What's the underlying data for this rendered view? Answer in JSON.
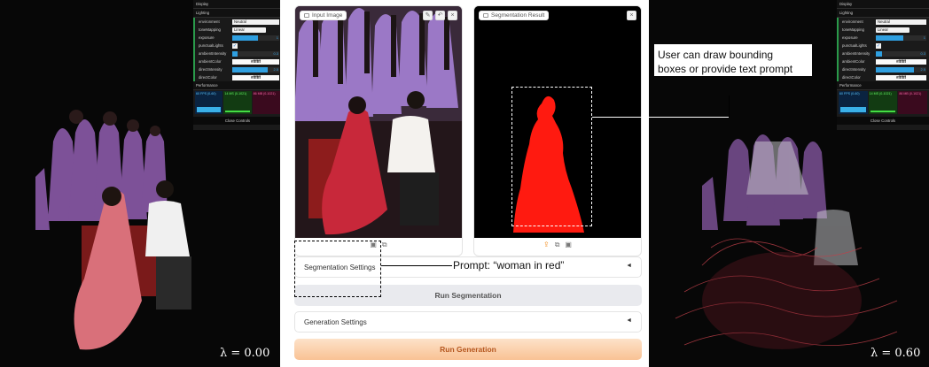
{
  "left_viewer": {
    "lambda_label": "λ = 0.00",
    "gui": {
      "folders": [
        "Display",
        "Lighting",
        "Performance"
      ],
      "environment": {
        "label": "environment",
        "value": "Neutral"
      },
      "toneMapping": {
        "label": "toneMapping",
        "value": "Linear"
      },
      "exposure": {
        "label": "exposure",
        "value": "1",
        "level": 0.55
      },
      "punctualLights": {
        "label": "punctualLights",
        "checked": true
      },
      "ambientIntensity": {
        "label": "ambientIntensity",
        "value": "0.3",
        "level": 0.12
      },
      "ambientColor": {
        "label": "ambientColor",
        "value": "#ffffff"
      },
      "directIntensity": {
        "label": "directIntensity",
        "value": "2.5",
        "level": 0.75
      },
      "directColor": {
        "label": "directColor",
        "value": "#ffffff"
      },
      "perf": {
        "fps": "60 FPS (0-60)",
        "ms": "14 MS (0-1021)",
        "mb": "86 MB (0-1021)"
      },
      "close_label": "Close Controls"
    }
  },
  "right_viewer": {
    "lambda_label": "λ = 0.60",
    "gui": {
      "folders": [
        "Display",
        "Lighting",
        "Performance"
      ],
      "environment": {
        "label": "environment",
        "value": "Neutral"
      },
      "toneMapping": {
        "label": "toneMapping",
        "value": "Linear"
      },
      "exposure": {
        "label": "exposure",
        "value": "1",
        "level": 0.55
      },
      "punctualLights": {
        "label": "punctualLights",
        "checked": true
      },
      "ambientIntensity": {
        "label": "ambientIntensity",
        "value": "0.3",
        "level": 0.12
      },
      "ambientColor": {
        "label": "ambientColor",
        "value": "#ffffff"
      },
      "directIntensity": {
        "label": "directIntensity",
        "value": "2.5",
        "level": 0.75
      },
      "directColor": {
        "label": "directColor",
        "value": "#ffffff"
      },
      "perf": {
        "fps": "60 FPS (0-60)",
        "ms": "14 MS (0-1021)",
        "mb": "86 MB (0-1021)"
      },
      "close_label": "Close Controls"
    }
  },
  "app": {
    "input_panel": {
      "label": "Input Image",
      "icons": [
        "pencil-icon",
        "undo-icon",
        "close-icon"
      ]
    },
    "seg_panel": {
      "label": "Segmentation Result",
      "icons": [
        "close-icon"
      ]
    },
    "seg_toolbar_icons": [
      "upload-icon",
      "clipboard-icon",
      "delete-icon"
    ],
    "segmentation_settings": "Segmentation Settings",
    "run_segmentation": "Run Segmentation",
    "generation_settings": "Generation Settings",
    "run_generation": "Run Generation",
    "caret": "◄"
  },
  "annotations": {
    "bbox_line1": "User can draw bounding",
    "bbox_line2": "boxes or provide text prompt",
    "prompt": "Prompt: “woman in red”"
  },
  "colors": {
    "accent_orange": "#f28c1c",
    "segmentation_mask": "#ff1a10",
    "gui_slider": "#2f9fe0"
  }
}
